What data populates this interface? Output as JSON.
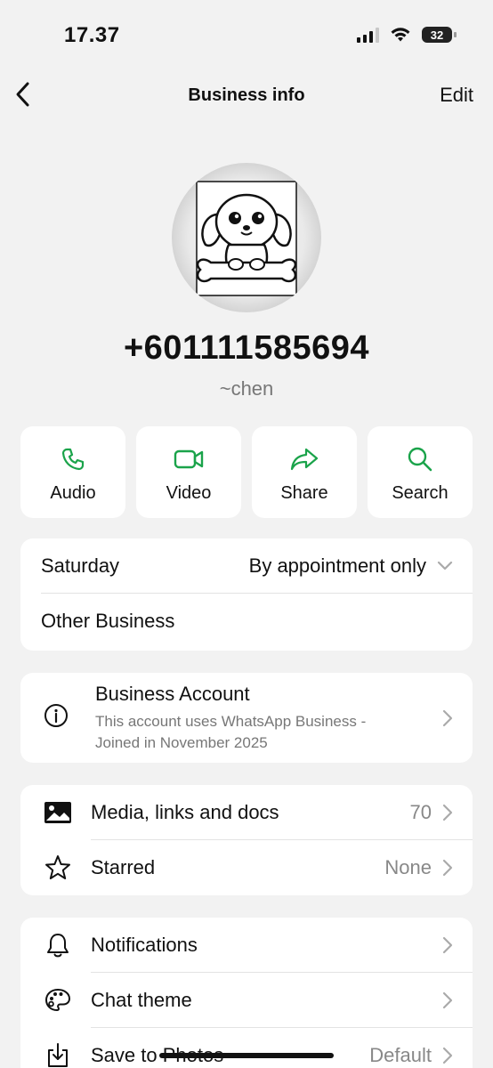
{
  "status_bar": {
    "time": "17.37",
    "battery": "32"
  },
  "nav": {
    "title": "Business info",
    "edit_label": "Edit"
  },
  "profile": {
    "phone": "+601111585694",
    "name": "~chen"
  },
  "actions": [
    {
      "label": "Audio",
      "icon": "phone-icon"
    },
    {
      "label": "Video",
      "icon": "video-icon"
    },
    {
      "label": "Share",
      "icon": "share-icon"
    },
    {
      "label": "Search",
      "icon": "search-icon"
    }
  ],
  "hours": {
    "day": "Saturday",
    "value": "By appointment only"
  },
  "category": "Other Business",
  "business_account": {
    "title": "Business Account",
    "description": "This account uses WhatsApp Business - Joined in November 2025"
  },
  "media": {
    "media_label": "Media, links and docs",
    "media_count": "70",
    "starred_label": "Starred",
    "starred_value": "None"
  },
  "settings": {
    "notifications_label": "Notifications",
    "chat_theme_label": "Chat theme",
    "save_photos_label": "Save to Photos",
    "save_photos_value": "Default"
  },
  "colors": {
    "accent_green": "#1aa34a",
    "background": "#f2f2f2",
    "card": "#ffffff"
  }
}
